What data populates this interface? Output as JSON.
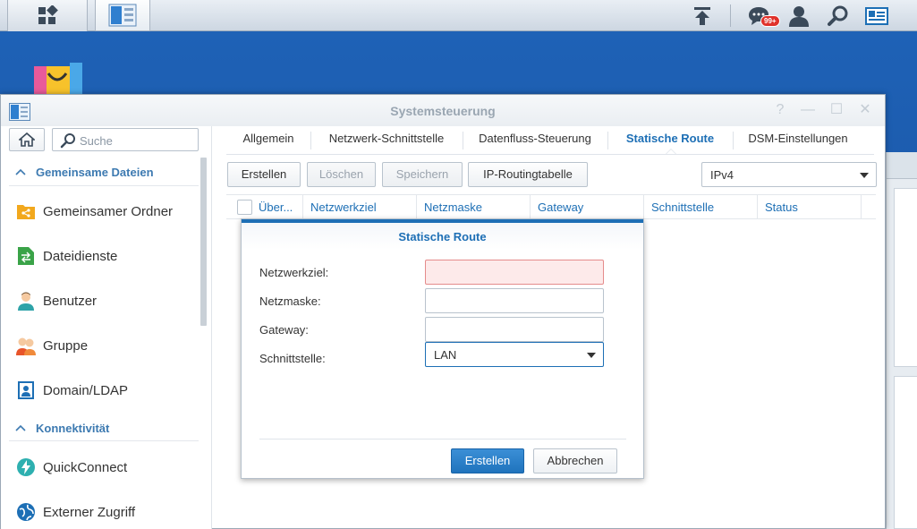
{
  "taskbar": {
    "notification_count": "99+"
  },
  "window": {
    "title": "Systemsteuerung",
    "help_glyph": "?",
    "minimize_glyph": "—",
    "maximize_glyph": "☐",
    "close_glyph": "✕"
  },
  "sidebar": {
    "search_placeholder": "Suche",
    "sections": [
      {
        "title": "Gemeinsame Dateien",
        "items": [
          {
            "label": "Gemeinsamer Ordner",
            "icon": "shared-folder-icon"
          },
          {
            "label": "Dateidienste",
            "icon": "file-services-icon"
          },
          {
            "label": "Benutzer",
            "icon": "user-icon"
          },
          {
            "label": "Gruppe",
            "icon": "group-icon"
          },
          {
            "label": "Domain/LDAP",
            "icon": "domain-ldap-icon"
          }
        ]
      },
      {
        "title": "Konnektivität",
        "items": [
          {
            "label": "QuickConnect",
            "icon": "quickconnect-icon"
          },
          {
            "label": "Externer Zugriff",
            "icon": "external-access-icon"
          }
        ]
      }
    ]
  },
  "tabs": [
    {
      "label": "Allgemein",
      "active": false
    },
    {
      "label": "Netzwerk-Schnittstelle",
      "active": false
    },
    {
      "label": "Datenfluss-Steuerung",
      "active": false
    },
    {
      "label": "Statische Route",
      "active": true
    },
    {
      "label": "DSM-Einstellungen",
      "active": false
    }
  ],
  "toolbar": {
    "create": "Erstellen",
    "delete": "Löschen",
    "save": "Speichern",
    "routing_table": "IP-Routingtabelle",
    "ip_version": "IPv4"
  },
  "grid": {
    "columns": [
      "Über...",
      "Netzwerkziel",
      "Netzmaske",
      "Gateway",
      "Schnittstelle",
      "Status"
    ]
  },
  "dialog": {
    "title": "Statische Route",
    "fields": {
      "network_target": {
        "label": "Netzwerkziel:",
        "value": ""
      },
      "netmask": {
        "label": "Netzmaske:",
        "value": ""
      },
      "gateway": {
        "label": "Gateway:",
        "value": ""
      },
      "interface": {
        "label": "Schnittstelle:",
        "value": "LAN"
      }
    },
    "create": "Erstellen",
    "cancel": "Abbrechen"
  },
  "colors": {
    "accent": "#1d6fb5",
    "section_title": "#3d7ab1",
    "invalid_bg": "#fdeaea",
    "desktop": "#1f63b8"
  }
}
